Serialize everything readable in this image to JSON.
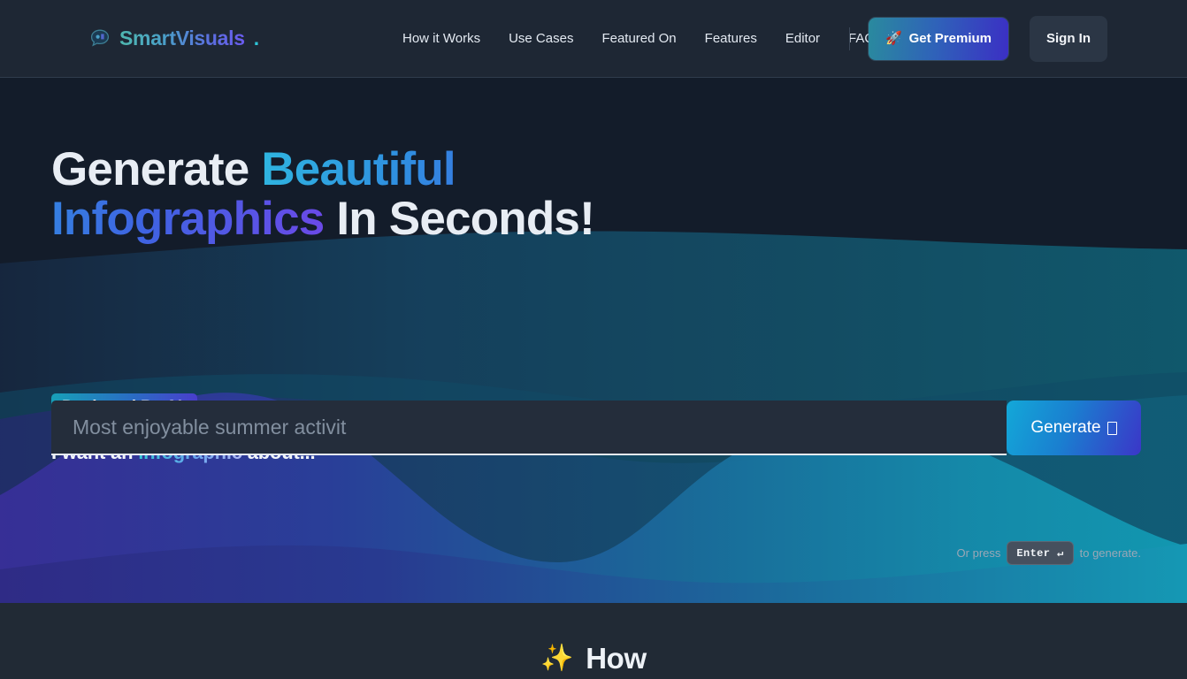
{
  "brand": {
    "icon": "chat-bubble-icon",
    "name": "SmartVisuals",
    "dot": "."
  },
  "nav": {
    "items": [
      {
        "label": "How it Works"
      },
      {
        "label": "Use Cases"
      },
      {
        "label": "Featured On"
      },
      {
        "label": "Features"
      },
      {
        "label": "Editor"
      },
      {
        "label": "FAQs"
      }
    ]
  },
  "header": {
    "premium_label": "Get Premium",
    "premium_icon": "rocket-icon",
    "premium_emoji": "🚀",
    "signin_label": "Sign In"
  },
  "hero": {
    "headline_part1": "Generate ",
    "headline_gradient": "Beautiful Infographics",
    "headline_part2": " In Seconds!",
    "badge": "Designed By AI.",
    "prompt_label_pre": "I want an ",
    "prompt_label_kw": "infographic",
    "prompt_label_post": " about...",
    "search_placeholder": "Most enjoyable summer activit",
    "search_value": "",
    "generate_label": "Generate",
    "generate_icon": "missing-glyph-box",
    "hint_pre": "Or press",
    "hint_key": "Enter ↵",
    "hint_post": "to generate."
  },
  "section_how": {
    "icon": "sparkles-icon",
    "emoji": "✨",
    "title": "How"
  },
  "colors": {
    "header_bg": "#1e2734",
    "hero_bg": "#131c2a",
    "section_bg": "#212a35",
    "accent_cyan": "#2ec5d8",
    "accent_blue": "#2f8fe0",
    "accent_purple": "#4a3ccc",
    "wave_purple": "#2f2b86",
    "wave_blue": "#1d4f9c",
    "wave_teal": "#1590b0",
    "wave_deep_teal": "#12607d",
    "input_bg": "#242d3b",
    "signin_bg": "#2b3645"
  }
}
